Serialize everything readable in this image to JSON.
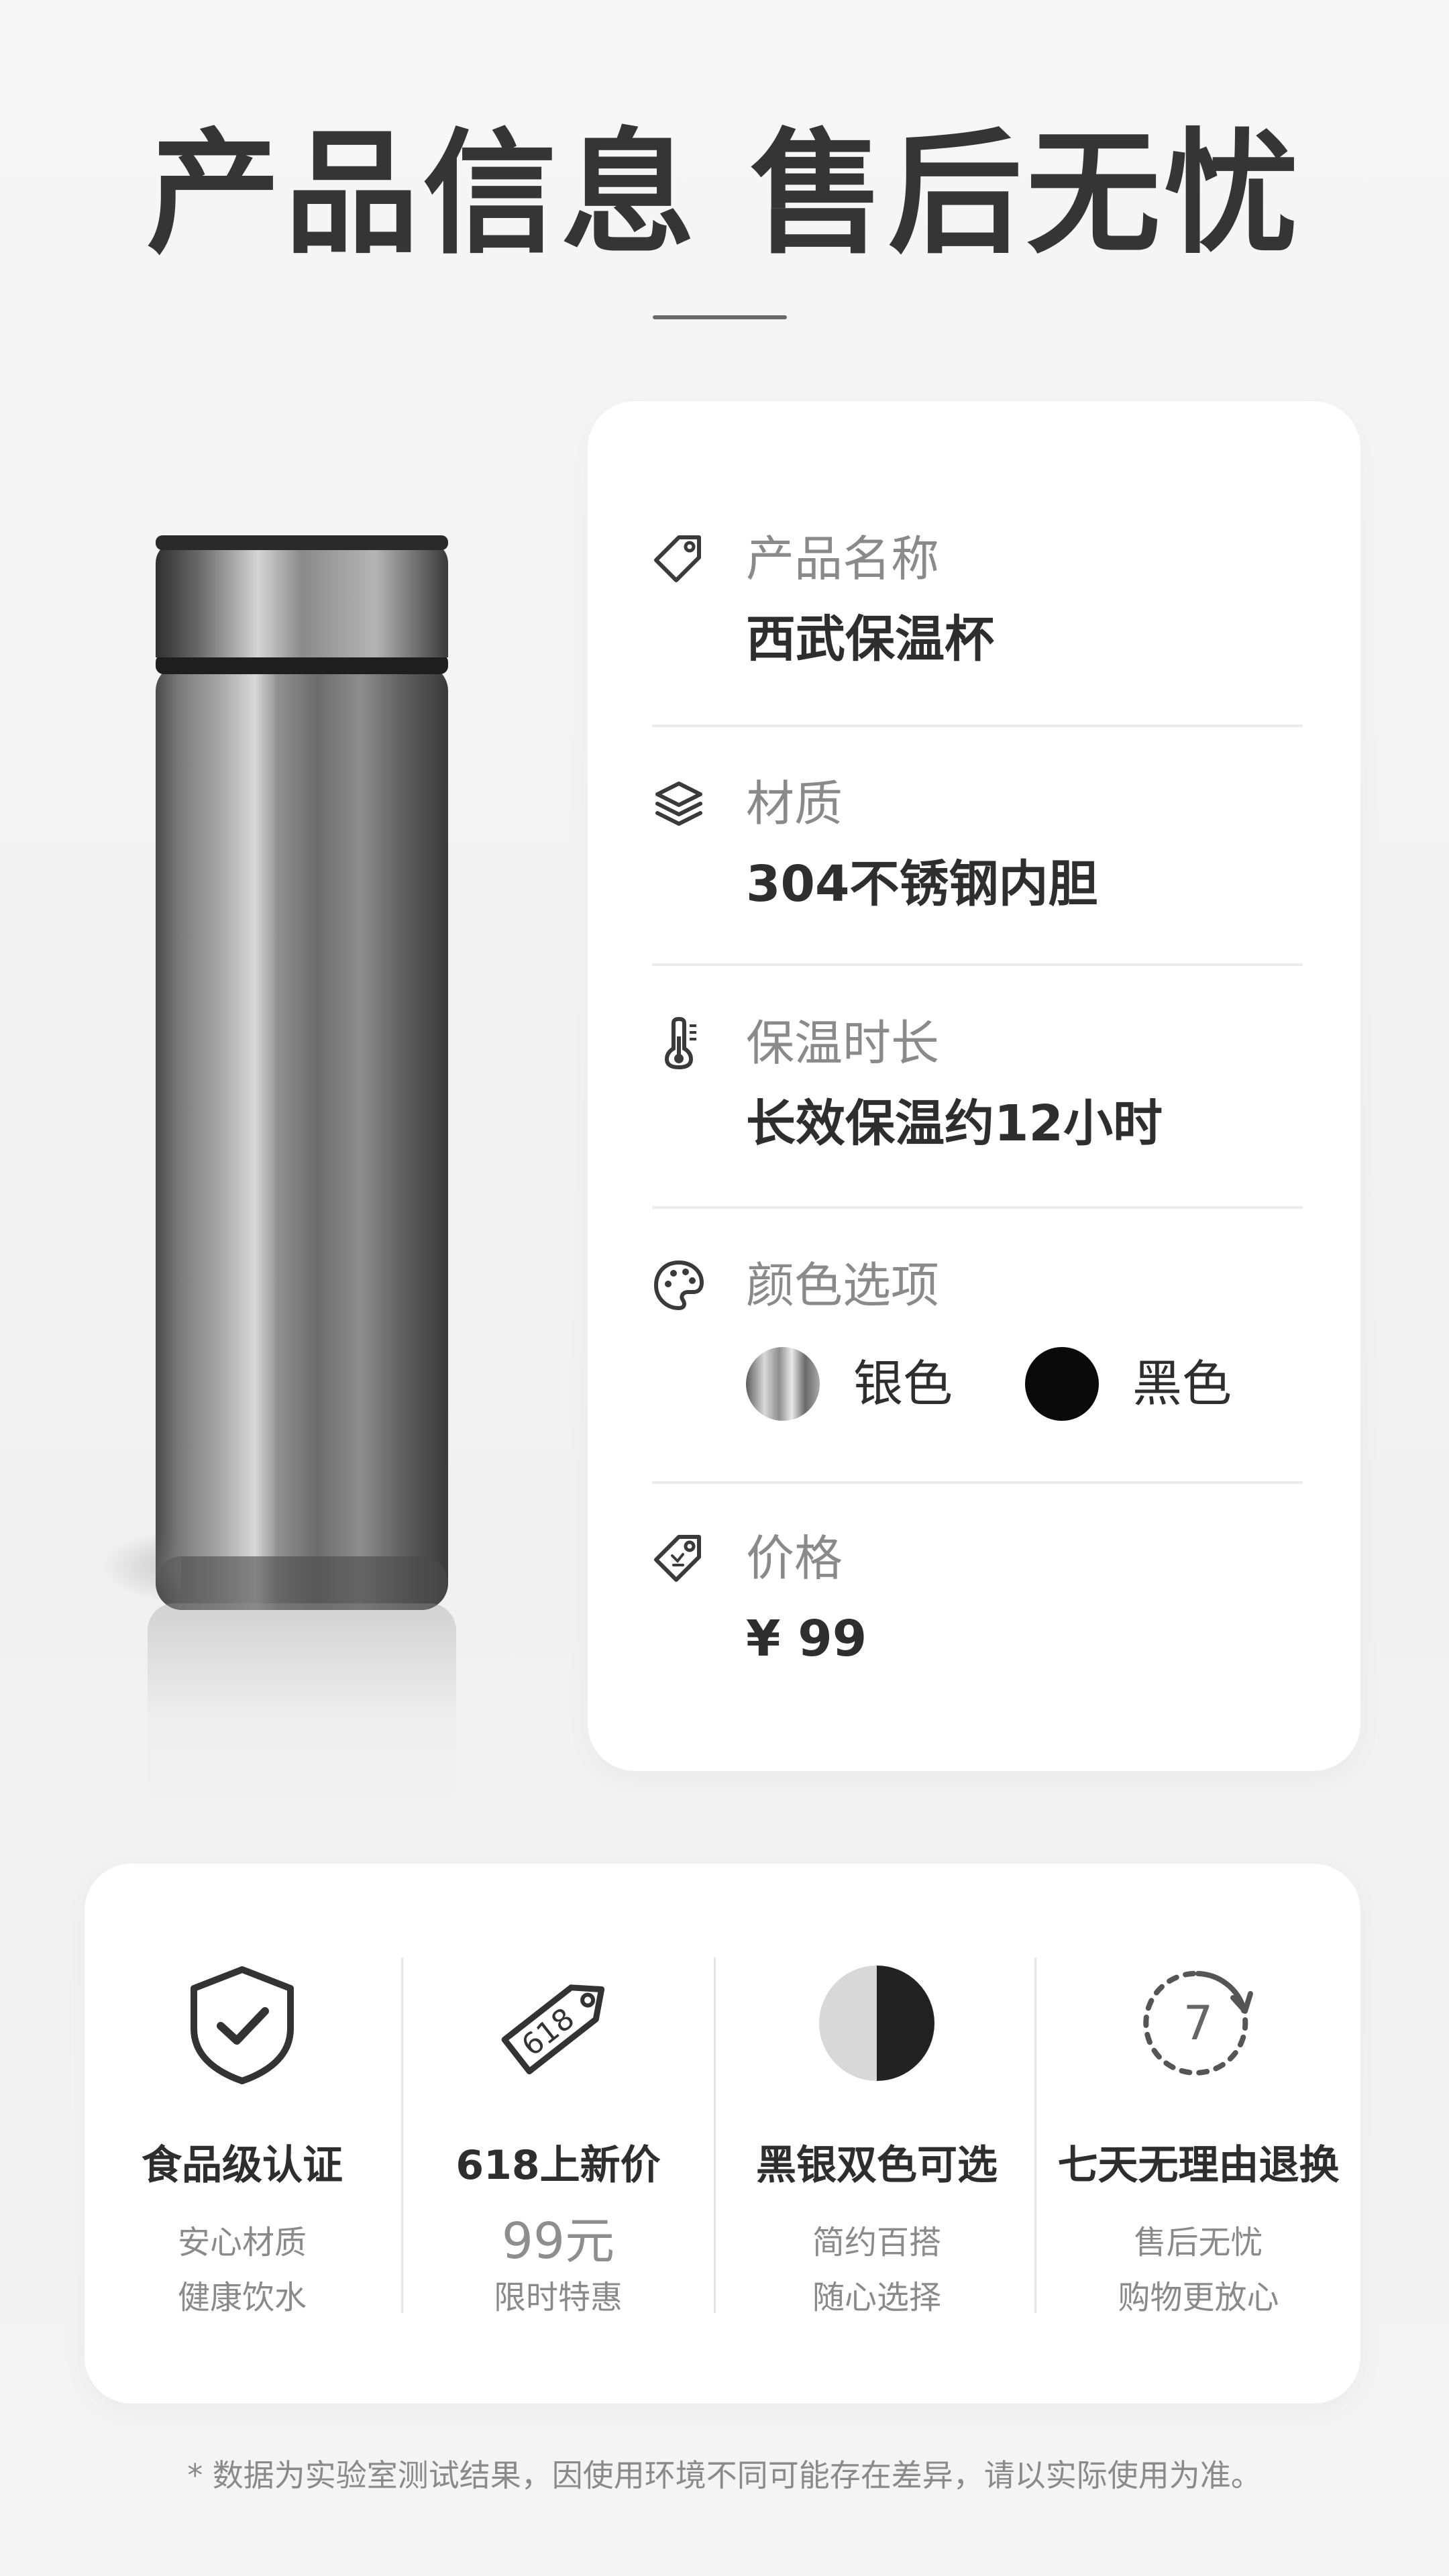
{
  "header": {
    "title": "产品信息 售后无忧"
  },
  "info": {
    "name": {
      "label": "产品名称",
      "value": "西武保温杯"
    },
    "material": {
      "label": "材质",
      "value": "304不锈钢内胆"
    },
    "insulation": {
      "label": "保温时长",
      "value": "长效保温约12小时"
    },
    "colors": {
      "label": "颜色选项",
      "options": [
        {
          "name": "银色",
          "color": "#b9b9b9"
        },
        {
          "name": "黑色",
          "color": "#0a0a0a"
        }
      ]
    },
    "price": {
      "label": "价格",
      "value": "¥ 99"
    }
  },
  "features": [
    {
      "icon": "shield-check-icon",
      "title": "食品级认证",
      "lines": [
        "安心材质",
        "健康饮水"
      ]
    },
    {
      "icon": "price-tag-618-icon",
      "tag_text": "618",
      "title": "618上新价",
      "price": "99元",
      "lines": [
        "限时特惠"
      ]
    },
    {
      "icon": "half-black-half-silver-icon",
      "title": "黑银双色可选",
      "lines": [
        "简约百搭",
        "随心选择"
      ]
    },
    {
      "icon": "seven-day-return-icon",
      "badge": "7",
      "title": "七天无理由退换",
      "lines": [
        "售后无忧",
        "购物更放心"
      ]
    }
  ],
  "footnote": "* 数据为实验室测试结果，因使用环境不同可能存在差异，请以实际使用为准。"
}
